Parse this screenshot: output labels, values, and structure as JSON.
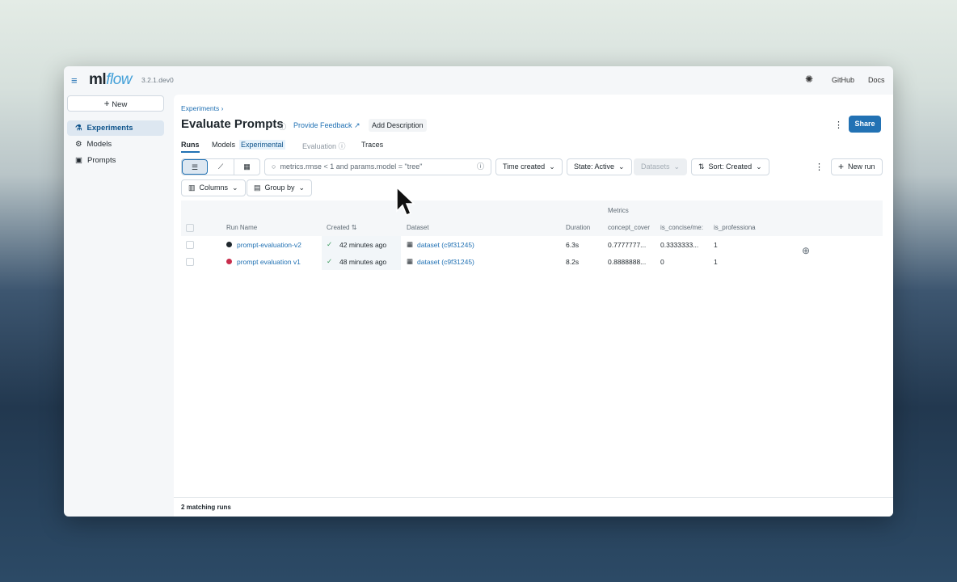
{
  "header": {
    "logo": "mlflow",
    "version": "3.2.1.dev0",
    "links": [
      "GitHub",
      "Docs"
    ]
  },
  "sidebar": {
    "new_label": "New",
    "items": [
      {
        "label": "Experiments",
        "active": true
      },
      {
        "label": "Models"
      },
      {
        "label": "Prompts"
      }
    ]
  },
  "page": {
    "breadcrumb": "Experiments",
    "title": "Evaluate Prompts",
    "feedback": "Provide Feedback",
    "add_description": "Add Description",
    "share": "Share"
  },
  "tabs": [
    {
      "label": "Runs",
      "active": true
    },
    {
      "label": "Models"
    },
    {
      "label": "Experimental"
    },
    {
      "label": "Evaluation"
    },
    {
      "label": "Traces"
    }
  ],
  "toolbar": {
    "search_value": "metrics.rmse < 1 and params.model = \"tree\"",
    "time_created": "Time created",
    "state": "State: Active",
    "datasets": "Datasets",
    "sort": "Sort: Created",
    "new_run": "New run",
    "columns": "Columns",
    "group_by": "Group by"
  },
  "table": {
    "group_header": "Metrics",
    "headers": [
      "Run Name",
      "Created",
      "Dataset",
      "Duration",
      "concept_cover",
      "is_concise/me:",
      "is_professiona"
    ],
    "rows": [
      {
        "name": "prompt-evaluation-v2",
        "color": "#1f272d",
        "created": "42 minutes ago",
        "dataset": "dataset (c9f31245)",
        "duration": "6.3s",
        "m1": "0.7777777...",
        "m2": "0.3333333...",
        "m3": "1"
      },
      {
        "name": "prompt evaluation v1",
        "color": "#c82d4c",
        "created": "48 minutes ago",
        "dataset": "dataset (c9f31245)",
        "duration": "8.2s",
        "m1": "0.8888888...",
        "m2": "0",
        "m3": "1"
      }
    ]
  },
  "footer": "2 matching runs"
}
